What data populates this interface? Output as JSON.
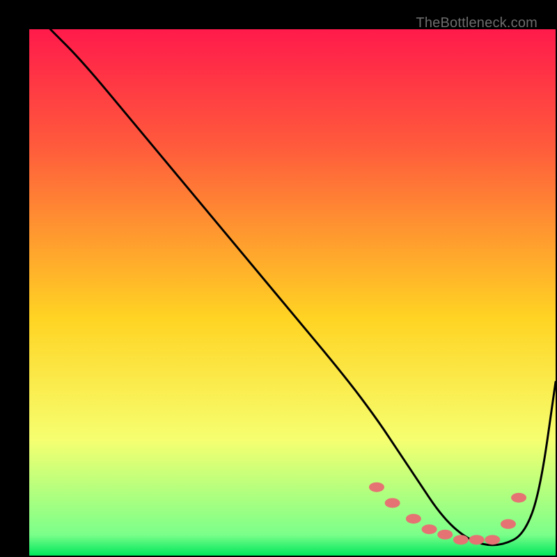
{
  "watermark": "TheBottleneck.com",
  "chart_data": {
    "type": "line",
    "title": "",
    "xlabel": "",
    "ylabel": "",
    "xlim": [
      0,
      100
    ],
    "ylim": [
      0,
      100
    ],
    "gradient_stops": [
      {
        "offset": 0.0,
        "color": "#ff1a4b"
      },
      {
        "offset": 0.22,
        "color": "#ff5a3c"
      },
      {
        "offset": 0.55,
        "color": "#ffd423"
      },
      {
        "offset": 0.78,
        "color": "#f6ff70"
      },
      {
        "offset": 0.96,
        "color": "#7bff8a"
      },
      {
        "offset": 1.0,
        "color": "#00e65c"
      }
    ],
    "series": [
      {
        "name": "bottleneck-curve",
        "color": "#000000",
        "x": [
          4,
          10,
          20,
          30,
          40,
          50,
          60,
          66,
          70,
          74,
          78,
          82,
          86,
          90,
          94,
          97,
          100
        ],
        "values": [
          100,
          94,
          82,
          70,
          58,
          46,
          34,
          26,
          20,
          14,
          8,
          4,
          2,
          2,
          4,
          12,
          33
        ]
      }
    ],
    "markers": {
      "name": "highlight-dots",
      "color": "#e57373",
      "x": [
        66,
        69,
        73,
        76,
        79,
        82,
        85,
        88,
        91,
        93
      ],
      "values": [
        13,
        10,
        7,
        5,
        4,
        3,
        3,
        3,
        6,
        11
      ]
    }
  }
}
